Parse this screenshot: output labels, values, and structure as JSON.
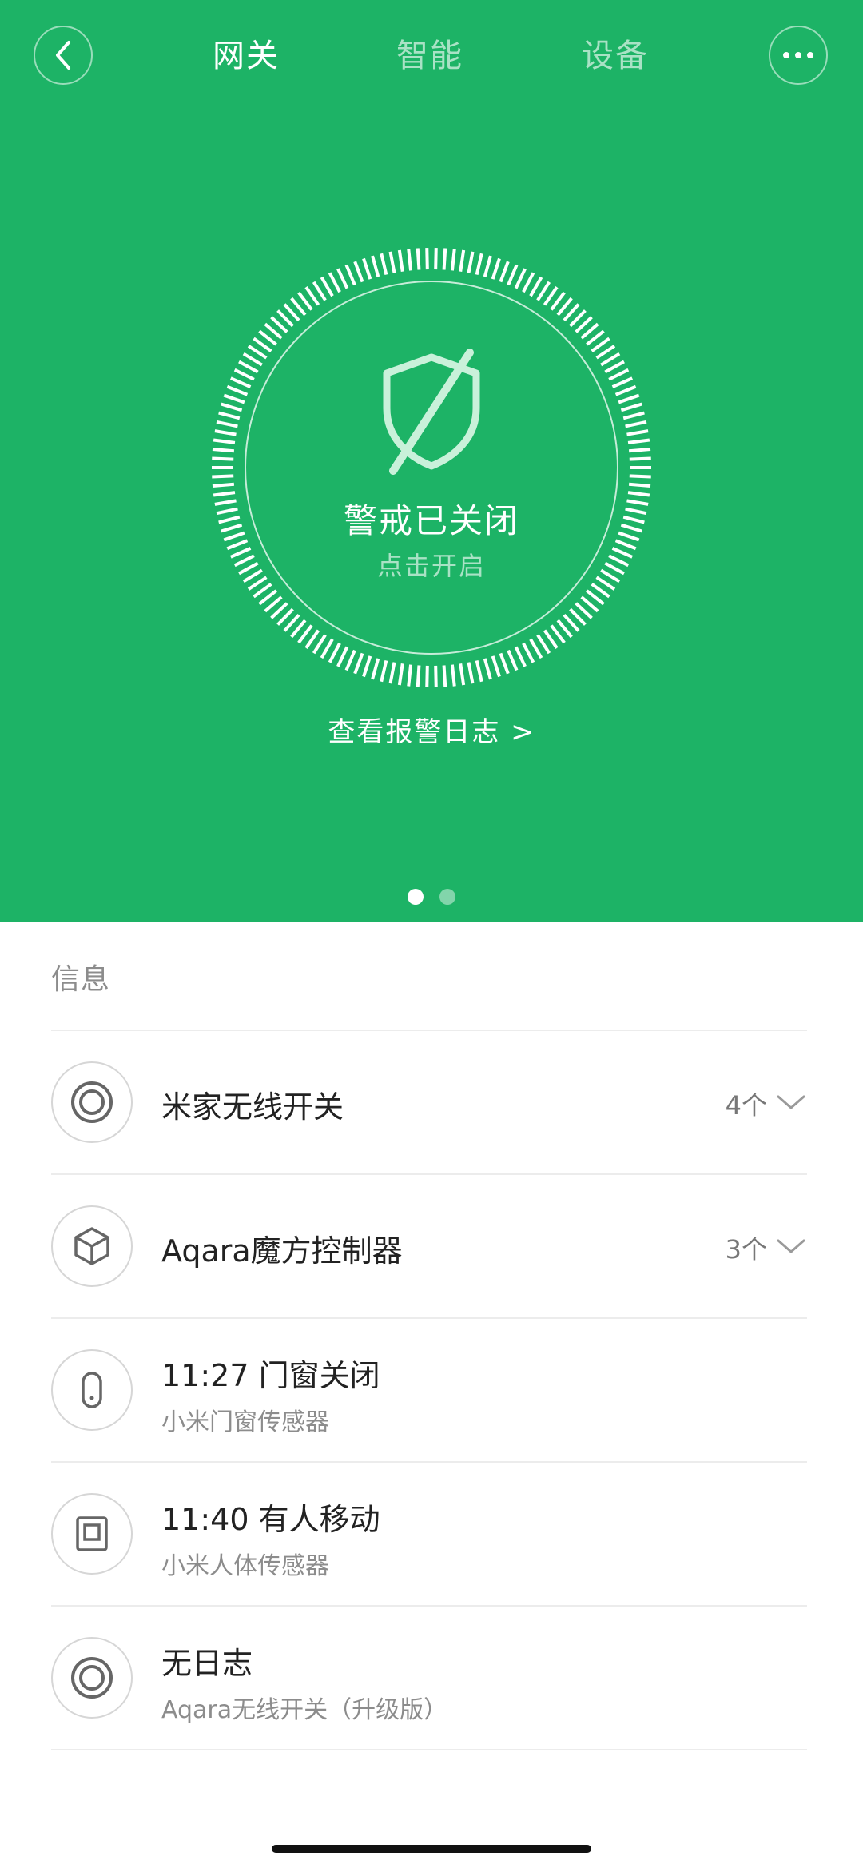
{
  "header": {
    "tabs": [
      {
        "label": "网关"
      },
      {
        "label": "智能"
      },
      {
        "label": "设备"
      }
    ]
  },
  "alarm": {
    "title": "警戒已关闭",
    "subtitle": "点击开启",
    "log_link": "查看报警日志  >"
  },
  "pager": {
    "current_page": 1,
    "page_count": 2
  },
  "info": {
    "section_label": "信息",
    "items": [
      {
        "title": "米家无线开关",
        "count": "4个",
        "icon": "wireless-switch-icon"
      },
      {
        "title": "Aqara魔方控制器",
        "count": "3个",
        "icon": "cube-icon"
      },
      {
        "title": "11:27 门窗关闭",
        "subtitle": "小米门窗传感器",
        "icon": "door-sensor-icon"
      },
      {
        "title": "11:40 有人移动",
        "subtitle": "小米人体传感器",
        "icon": "motion-sensor-icon"
      },
      {
        "title": "无日志",
        "subtitle": "Aqara无线开关（升级版）",
        "icon": "wireless-switch-icon"
      }
    ]
  },
  "colors": {
    "hero_bg": "#1db366",
    "text_primary": "#222222",
    "text_secondary": "#8c8c8c"
  }
}
